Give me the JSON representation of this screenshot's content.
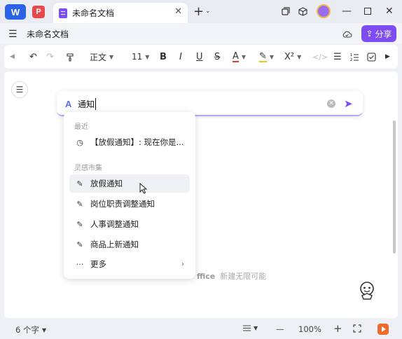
{
  "titlebar": {
    "app_logo": "W",
    "pdf_logo": "P",
    "tab_title": "未命名文档",
    "icons": [
      "close-icon",
      "plus-icon",
      "chevron-down-icon",
      "restore-icon",
      "box-icon",
      "avatar",
      "minimize-icon",
      "maximize-icon",
      "window-close-icon"
    ]
  },
  "menubar": {
    "doc_name": "未命名文档",
    "share_label": "分享"
  },
  "toolbar": {
    "style_label": "正文",
    "font_size": "11",
    "bold": "B",
    "italic": "I",
    "underline": "U",
    "strike": "S",
    "font_color": "A",
    "superscript": "X²"
  },
  "ai_input": {
    "logo": "A",
    "value": "通知"
  },
  "dropdown": {
    "recent_label": "最近",
    "recent_items": [
      {
        "label": "【放假通知】: 现在你是..."
      }
    ],
    "market_label": "灵感市集",
    "market_items": [
      {
        "label": "放假通知"
      },
      {
        "label": "岗位职责调整通知"
      },
      {
        "label": "人事调整通知"
      },
      {
        "label": "商品上新通知"
      }
    ],
    "more_label": "更多"
  },
  "document": {
    "hint_brand": "ffice",
    "hint_text": "新建无限可能"
  },
  "statusbar": {
    "word_count": "6 个字",
    "zoom": "100%"
  },
  "colors": {
    "accent": "#7d4df2",
    "wps_blue": "#2b63e6"
  }
}
